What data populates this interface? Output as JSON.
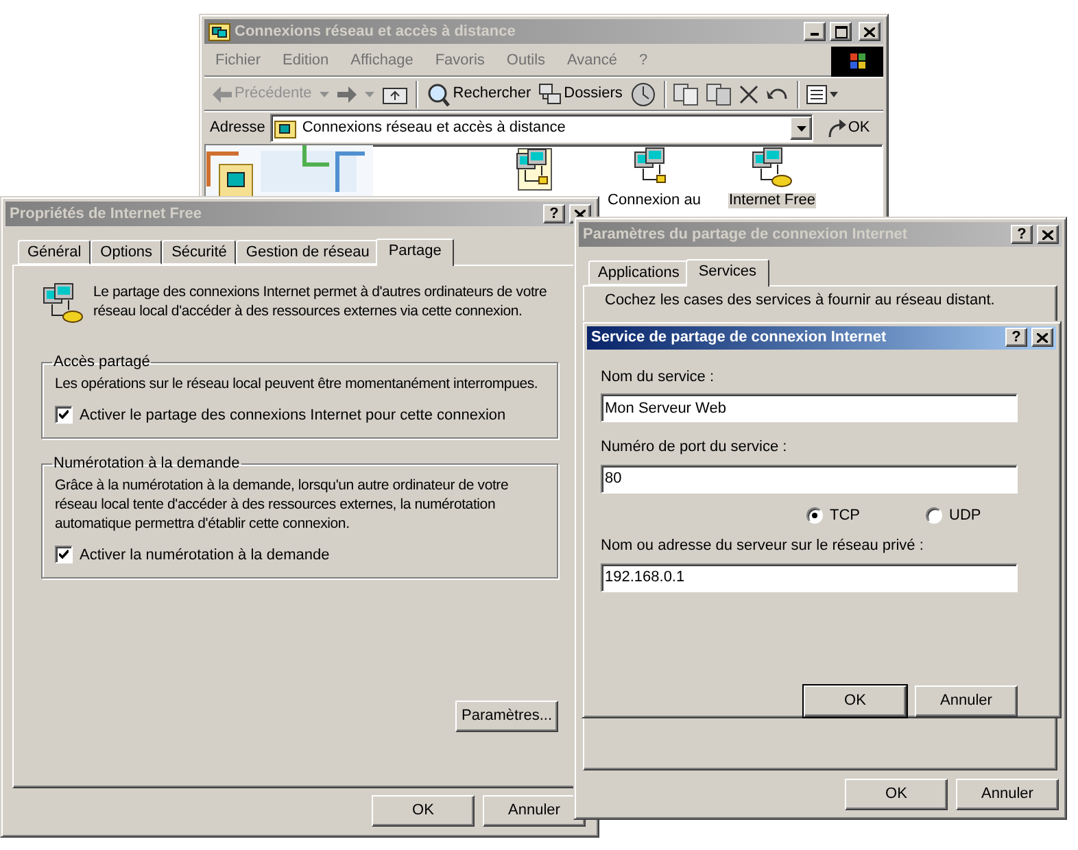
{
  "explorer": {
    "title": "Connexions réseau et accès à distance",
    "active": false,
    "menu": [
      "Fichier",
      "Edition",
      "Affichage",
      "Favoris",
      "Outils",
      "Avancé",
      "?"
    ],
    "toolbar": [
      {
        "kind": "back",
        "label": "Précédente",
        "disabled": true
      },
      {
        "kind": "search",
        "label": "Rechercher",
        "disabled": false
      },
      {
        "kind": "folders",
        "label": "Dossiers",
        "disabled": false
      }
    ],
    "address": {
      "label": "Adresse",
      "value": "Connexions réseau et accès à distance",
      "go": "OK"
    },
    "items": [
      {
        "label": "Connexion au",
        "selected": false
      },
      {
        "label": "Internet Free",
        "selected": true
      }
    ]
  },
  "properties": {
    "title": "Propriétés de Internet Free",
    "active": false,
    "help": "?",
    "tabs": [
      {
        "label": "Général",
        "selected": false
      },
      {
        "label": "Options",
        "selected": false
      },
      {
        "label": "Sécurité",
        "selected": false
      },
      {
        "label": "Gestion de réseau",
        "selected": false
      },
      {
        "label": "Partage",
        "selected": true
      }
    ],
    "description": "Le partage des connexions Internet permet à d'autres ordinateurs de votre réseau local d'accéder à des ressources externes via cette connexion.",
    "groups": [
      {
        "title": "Accès partagé",
        "text": "Les opérations sur le réseau local peuvent être momentanément interrompues.",
        "checkbox": {
          "label": "Activer le partage des connexions Internet pour cette connexion",
          "checked": true
        }
      },
      {
        "title": "Numérotation à la demande",
        "text": "Grâce à la numérotation à la demande, lorsqu'un autre ordinateur de votre réseau local tente d'accéder à des ressources externes, la numérotation automatique permettra d'établir cette connexion.",
        "checkbox": {
          "label": "Activer la numérotation à la demande",
          "checked": true
        }
      }
    ],
    "settings_button": "Paramètres...",
    "buttons": [
      "OK",
      "Annuler"
    ]
  },
  "sharing_settings": {
    "title": "Paramètres du partage de connexion Internet",
    "active": false,
    "help": "?",
    "tabs": [
      {
        "label": "Applications",
        "selected": false
      },
      {
        "label": "Services",
        "selected": true
      }
    ],
    "instruction": "Cochez les cases des services à fournir au réseau distant.",
    "buttons": [
      "OK",
      "Annuler"
    ]
  },
  "service": {
    "title": "Service de partage de connexion Internet",
    "active": true,
    "help": "?",
    "rows": [
      {
        "kind": "field",
        "label": "Nom du service :",
        "value": "Mon Serveur Web"
      },
      {
        "kind": "field",
        "label": "Numéro de port du service :",
        "value": "80"
      },
      {
        "kind": "radios",
        "options": [
          {
            "label": "TCP",
            "selected": true
          },
          {
            "label": "UDP",
            "selected": false
          }
        ]
      },
      {
        "kind": "field",
        "label": "Nom ou adresse du serveur sur le réseau privé :",
        "value": "192.168.0.1"
      }
    ],
    "buttons": [
      {
        "label": "OK",
        "default": true
      },
      {
        "label": "Annuler",
        "default": false
      }
    ]
  }
}
